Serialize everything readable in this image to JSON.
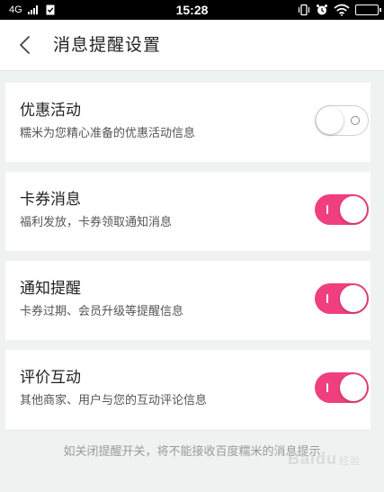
{
  "status_bar": {
    "network": "4G",
    "time": "15:28",
    "icons": [
      "signal-icon",
      "sim-card-icon",
      "vibrate-icon",
      "alarm-icon",
      "wifi-icon",
      "battery-icon"
    ]
  },
  "header": {
    "back_icon": "chevron-left-icon",
    "title": "消息提醒设置"
  },
  "settings": [
    {
      "title": "优惠活动",
      "description": "糯米为您精心准备的优惠活动信息",
      "enabled": false
    },
    {
      "title": "卡券消息",
      "description": "福利发放，卡券领取通知消息",
      "enabled": true
    },
    {
      "title": "通知提醒",
      "description": "卡券过期、会员升级等提醒信息",
      "enabled": true
    },
    {
      "title": "评价互动",
      "description": "其他商家、用户与您的互动评论信息",
      "enabled": true
    }
  ],
  "footer": {
    "note": "如关闭提醒开关，将不能接收百度糯米的消息提示"
  },
  "watermark": {
    "text": "Baidu",
    "sub": "经验"
  },
  "colors": {
    "toggle_on": "#f03f7e",
    "background": "#eef2f1",
    "status_bar": "#000000"
  }
}
